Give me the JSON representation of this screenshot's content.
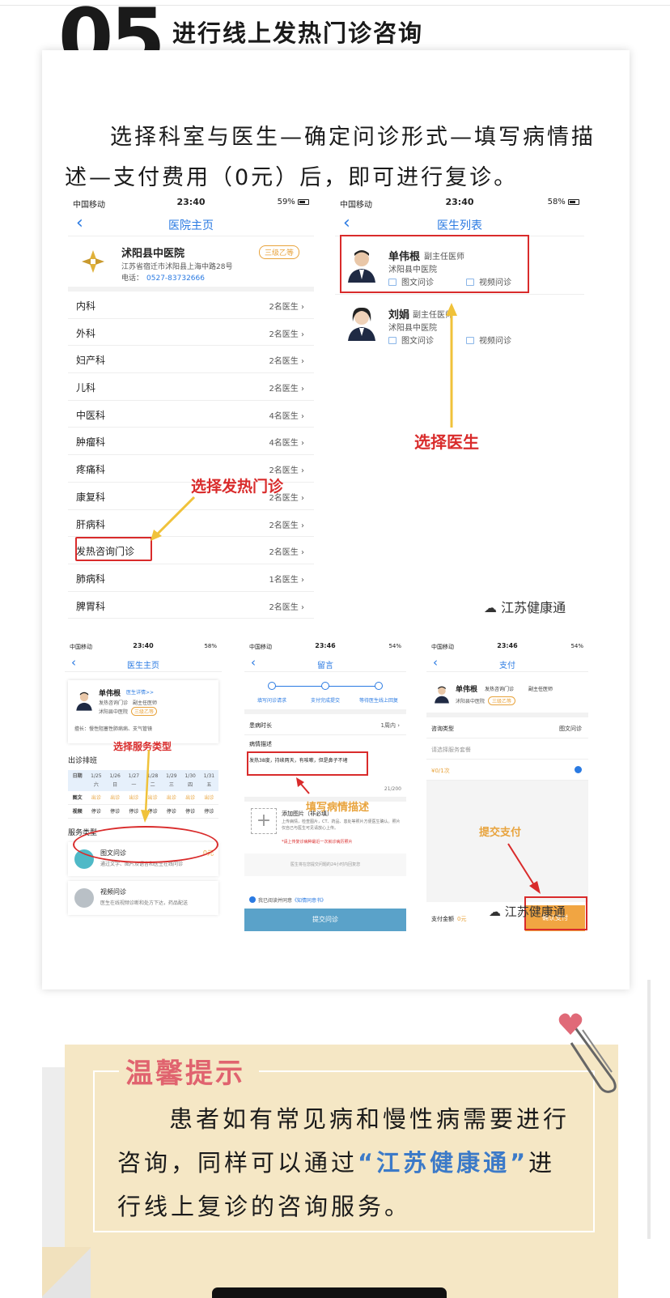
{
  "section": {
    "number": "05",
    "title": "进行线上发热门诊咨询"
  },
  "intro": "选择科室与医生—确定问诊形式—填写病情描述—支付费用（0元）后，即可进行复诊。",
  "phone1": {
    "status": {
      "carrier": "中国移动",
      "time": "23:40",
      "battery": "59%"
    },
    "title": "医院主页",
    "hospital": {
      "name": "沭阳县中医院",
      "badge": "三级乙等",
      "address": "江苏省宿迁市沭阳县上海中路28号",
      "tel_label": "电话：",
      "tel": "0527-83732666"
    },
    "departments": [
      {
        "name": "内科",
        "count": "2名医生"
      },
      {
        "name": "外科",
        "count": "2名医生"
      },
      {
        "name": "妇产科",
        "count": "2名医生"
      },
      {
        "name": "儿科",
        "count": "2名医生"
      },
      {
        "name": "中医科",
        "count": "4名医生"
      },
      {
        "name": "肿瘤科",
        "count": "4名医生"
      },
      {
        "name": "疼痛科",
        "count": "2名医生"
      },
      {
        "name": "康复科",
        "count": "2名医生"
      },
      {
        "name": "肝病科",
        "count": "2名医生"
      },
      {
        "name": "发热咨询门诊",
        "count": "2名医生"
      },
      {
        "name": "肺病科",
        "count": "1名医生"
      },
      {
        "name": "脾胃科",
        "count": "2名医生"
      }
    ],
    "annotation": "选择发热门诊"
  },
  "phone2": {
    "status": {
      "carrier": "中国移动",
      "time": "23:40",
      "battery": "58%"
    },
    "title": "医生列表",
    "doctors": [
      {
        "name": "单伟根",
        "title": "副主任医师",
        "hospital": "沭阳县中医院",
        "c1": "图文问诊",
        "c2": "视频问诊"
      },
      {
        "name": "刘娟",
        "title": "副主任医师",
        "hospital": "沭阳县中医院",
        "c1": "图文问诊",
        "c2": "视频问诊"
      }
    ],
    "annotation": "选择医生",
    "watermark": "江苏健康通"
  },
  "phone3": {
    "status": {
      "carrier": "中国移动",
      "time": "23:40",
      "battery": "58%"
    },
    "title": "医生主页",
    "doctor": {
      "name": "单伟根",
      "link": "医生详情>>",
      "line1": "发热咨询门诊　副主任医师",
      "hospital": "沭阳县中医院",
      "badge": "三级乙等",
      "skill": "擅长：慢性阻塞性肺病病、支气管镜"
    },
    "schedule_title": "出诊排班",
    "annotation": "选择服务类型",
    "schedule": {
      "dates": [
        "1/25",
        "1/26",
        "1/27",
        "1/28",
        "1/29",
        "1/30",
        "1/31"
      ],
      "days": [
        "六",
        "日",
        "一",
        "二",
        "三",
        "四",
        "五"
      ],
      "label_date": "日期",
      "label_img": "图文",
      "label_video": "视频",
      "out": "出诊",
      "stop": "停诊"
    },
    "service_title": "服务类型",
    "services": [
      {
        "name": "图文问诊",
        "desc": "通过文字、图片及语音和医生在线问诊",
        "price": "0元"
      },
      {
        "name": "视频问诊",
        "desc": "医生在线视频诊断和处方下达，药品配送"
      }
    ]
  },
  "phone4": {
    "status": {
      "carrier": "中国移动",
      "time": "23:46",
      "battery": "54%"
    },
    "title": "留言",
    "steps": [
      "填写问诊请求",
      "支付完成提交",
      "等待医生线上回复"
    ],
    "duration_label": "患病时长",
    "duration_value": "1周内",
    "desc_label": "病情描述",
    "desc_text": "发热38度，持续两天，有咳嗽，但是鼻子不堵",
    "desc_count": "21/200",
    "annotation": "填写病情描述",
    "add_title": "添加图片（非必填）",
    "add_desc": "上传病情，检查图片，CT、药品、患处等照片方便医生确认。照片仅自己与医生可见请放心上传。",
    "add_warn": "*请上传复诊病种最近一次就诊病历照片",
    "note": "医生将在您提交问题的24小时内回复您",
    "agree_pre": "我已阅读并同意",
    "agree_link": "《知情同意书》",
    "submit": "提交问诊"
  },
  "phone5": {
    "status": {
      "carrier": "中国移动",
      "time": "23:46",
      "battery": "54%"
    },
    "title": "支付",
    "doctor": {
      "name": "单伟根",
      "service": "发热咨询门诊",
      "title": "副主任医师",
      "hospital": "沭阳县中医院",
      "badge": "三级乙等"
    },
    "type_label": "咨询类型",
    "type_value": "图文问诊",
    "package_placeholder": "请选择服务套餐",
    "package_price": "¥0/1次",
    "annotation": "提交支付",
    "total_label": "支付金额",
    "total_value": "0元",
    "button": "确认支付",
    "watermark": "江苏健康通"
  },
  "tip": {
    "title": "温馨提示",
    "text_pre": "患者如有常见病和慢性病需要进行咨询，同样可以通过",
    "text_hl": "“江苏健康通”",
    "text_post": "进行线上复诊的咨询服务。"
  },
  "colors": {
    "accent_blue": "#2a7ae2",
    "annotation_red": "#d92b2b",
    "badge_orange": "#e8a33c",
    "tip_bg": "#f5e7c5",
    "tip_title": "#e0636f"
  }
}
